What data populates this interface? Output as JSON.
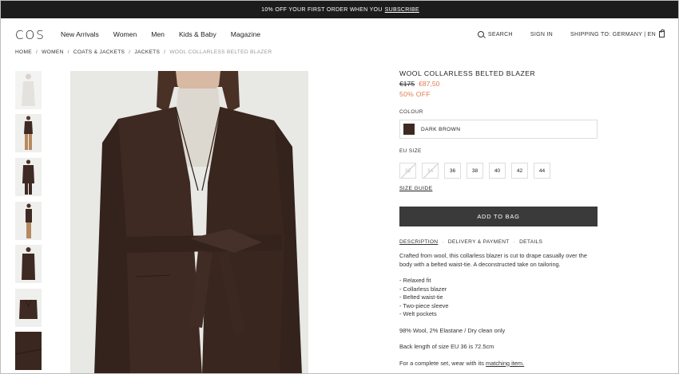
{
  "promo": {
    "text": "10% OFF YOUR FIRST ORDER WHEN YOU",
    "link": "SUBSCRIBE"
  },
  "header": {
    "logo": "COS",
    "nav": [
      "New Arrivals",
      "Women",
      "Men",
      "Kids & Baby",
      "Magazine"
    ],
    "search": "SEARCH",
    "signin": "SIGN IN",
    "shipping": "SHIPPING TO: GERMANY | EN"
  },
  "breadcrumb": [
    "HOME",
    "WOMEN",
    "COATS & JACKETS",
    "JACKETS",
    "WOOL COLLARLESS BELTED BLAZER"
  ],
  "product": {
    "title": "WOOL COLLARLESS BELTED BLAZER",
    "old_price": "€175",
    "new_price": "€87,50",
    "discount": "50% OFF",
    "colour_label": "COLOUR",
    "colour_name": "DARK BROWN",
    "colour_hex": "#3e2a22",
    "size_label": "EU SIZE",
    "sizes": [
      {
        "label": "32",
        "available": false
      },
      {
        "label": "34",
        "available": false
      },
      {
        "label": "36",
        "available": true
      },
      {
        "label": "38",
        "available": true
      },
      {
        "label": "40",
        "available": true
      },
      {
        "label": "42",
        "available": true
      },
      {
        "label": "44",
        "available": true
      }
    ],
    "size_guide": "SIZE GUIDE",
    "add_to_bag": "ADD TO BAG",
    "tabs": [
      "DESCRIPTION",
      "DELIVERY & PAYMENT",
      "DETAILS"
    ],
    "description": "Crafted from wool, this collarless blazer is cut to drape casually over the body with a belted waist-tie. A deconstructed take on tailoring.",
    "features": [
      "- Relaxed fit",
      "- Collarless blazer",
      "- Belted waist-tie",
      "- Two-piece sleeve",
      "- Welt pockets"
    ],
    "composition": "98% Wool, 2% Elastane / Dry clean only",
    "back_length": "Back length of size EU 36 is 72.5cm",
    "complete_set_text": "For a complete set, wear with its",
    "complete_set_link": "matching item."
  },
  "colors": {
    "accent": "#e07a4f",
    "button": "#3a3a3a",
    "jacket": "#3e2a22"
  }
}
